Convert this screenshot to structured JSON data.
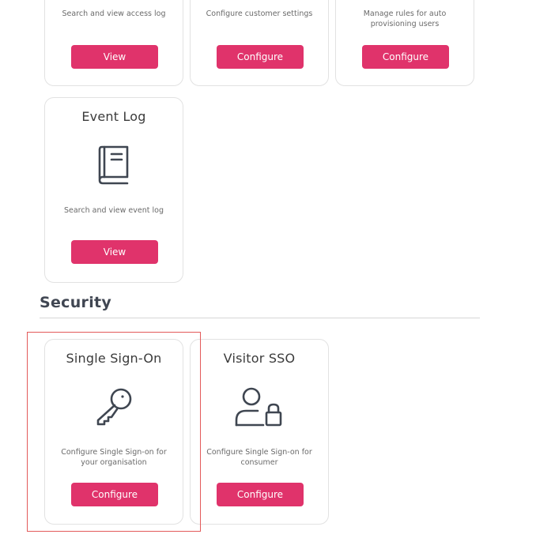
{
  "top_cards": [
    {
      "description": "Search and view access log",
      "button_label": "View"
    },
    {
      "description": "Configure customer settings",
      "button_label": "Configure"
    },
    {
      "description": "Manage rules for auto provisioning users",
      "button_label": "Configure"
    }
  ],
  "event_log_card": {
    "title": "Event Log",
    "icon": "book-icon",
    "description": "Search and view event log",
    "button_label": "View"
  },
  "security_section": {
    "heading": "Security",
    "cards": [
      {
        "title": "Single Sign-On",
        "icon": "key-icon",
        "description": "Configure Single Sign-on for your organisation",
        "button_label": "Configure"
      },
      {
        "title": "Visitor SSO",
        "icon": "user-lock-icon",
        "description": "Configure Single Sign-on for consumer",
        "button_label": "Configure"
      }
    ]
  },
  "colors": {
    "accent": "#e0336b",
    "highlight": "#e35a5a",
    "icon": "#3f4651"
  }
}
